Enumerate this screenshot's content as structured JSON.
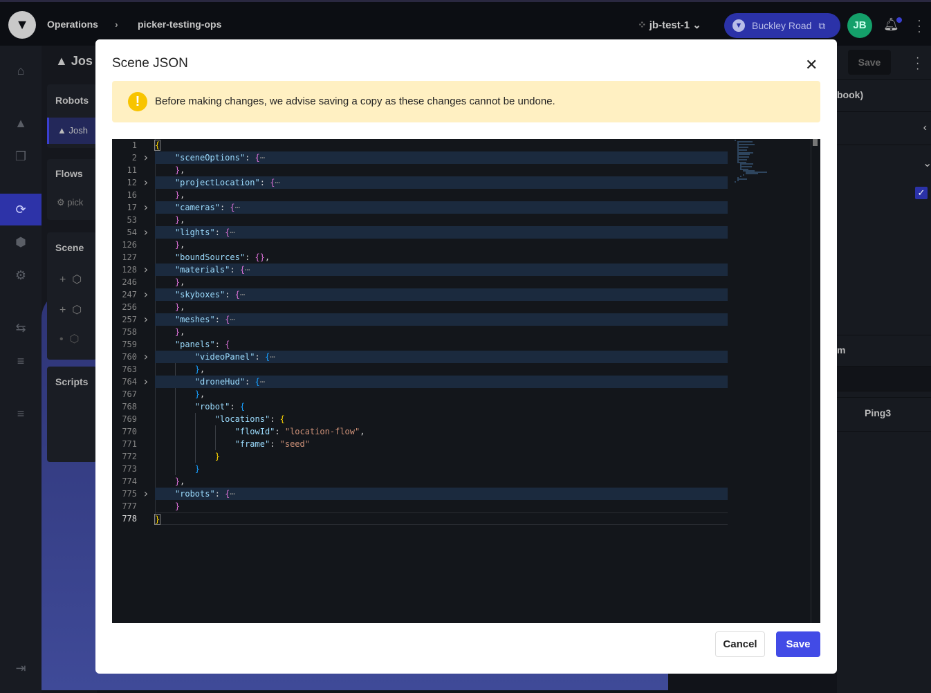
{
  "topbar": {
    "breadcrumb": [
      "Operations",
      "picker-testing-ops"
    ],
    "project": "jb-test-1",
    "site": "Buckley Road",
    "avatar_initials": "JB"
  },
  "background": {
    "robot_header": "Jos",
    "cards": {
      "robots": "Robots",
      "robot_item": "Josh",
      "flows": "Flows",
      "flow_item": "pick",
      "scene": "Scene",
      "scripts": "Scripts"
    },
    "right": {
      "save": "Save",
      "row1": "book)",
      "row2": "m",
      "row3": "Ping3"
    }
  },
  "modal": {
    "title": "Scene JSON",
    "warning": "Before making changes, we advise saving a copy as these changes cannot be undone.",
    "cancel": "Cancel",
    "save": "Save",
    "editor": {
      "lines": [
        {
          "n": "1",
          "fold": false,
          "tokens": [
            [
              "{",
              "b1 cursor"
            ]
          ]
        },
        {
          "n": "2",
          "fold": true,
          "tokens": [
            [
              "    ",
              ""
            ],
            [
              "\"sceneOptions\"",
              "k"
            ],
            [
              ": ",
              ""
            ],
            [
              "{",
              "b2"
            ],
            [
              "⋯",
              "e"
            ]
          ]
        },
        {
          "n": "11",
          "fold": false,
          "tokens": [
            [
              "    ",
              ""
            ],
            [
              "}",
              "b2"
            ],
            [
              ",",
              ""
            ]
          ]
        },
        {
          "n": "12",
          "fold": true,
          "tokens": [
            [
              "    ",
              ""
            ],
            [
              "\"projectLocation\"",
              "k"
            ],
            [
              ": ",
              ""
            ],
            [
              "{",
              "b2"
            ],
            [
              "⋯",
              "e"
            ]
          ]
        },
        {
          "n": "16",
          "fold": false,
          "tokens": [
            [
              "    ",
              ""
            ],
            [
              "}",
              "b2"
            ],
            [
              ",",
              ""
            ]
          ]
        },
        {
          "n": "17",
          "fold": true,
          "tokens": [
            [
              "    ",
              ""
            ],
            [
              "\"cameras\"",
              "k"
            ],
            [
              ": ",
              ""
            ],
            [
              "{",
              "b2"
            ],
            [
              "⋯",
              "e"
            ]
          ]
        },
        {
          "n": "53",
          "fold": false,
          "tokens": [
            [
              "    ",
              ""
            ],
            [
              "}",
              "b2"
            ],
            [
              ",",
              ""
            ]
          ]
        },
        {
          "n": "54",
          "fold": true,
          "tokens": [
            [
              "    ",
              ""
            ],
            [
              "\"lights\"",
              "k"
            ],
            [
              ": ",
              ""
            ],
            [
              "{",
              "b2"
            ],
            [
              "⋯",
              "e"
            ]
          ]
        },
        {
          "n": "126",
          "fold": false,
          "tokens": [
            [
              "    ",
              ""
            ],
            [
              "}",
              "b2"
            ],
            [
              ",",
              ""
            ]
          ]
        },
        {
          "n": "127",
          "fold": false,
          "tokens": [
            [
              "    ",
              ""
            ],
            [
              "\"boundSources\"",
              "k"
            ],
            [
              ": ",
              ""
            ],
            [
              "{}",
              "b2"
            ],
            [
              ",",
              ""
            ]
          ]
        },
        {
          "n": "128",
          "fold": true,
          "tokens": [
            [
              "    ",
              ""
            ],
            [
              "\"materials\"",
              "k"
            ],
            [
              ": ",
              ""
            ],
            [
              "{",
              "b2"
            ],
            [
              "⋯",
              "e"
            ]
          ]
        },
        {
          "n": "246",
          "fold": false,
          "tokens": [
            [
              "    ",
              ""
            ],
            [
              "}",
              "b2"
            ],
            [
              ",",
              ""
            ]
          ]
        },
        {
          "n": "247",
          "fold": true,
          "tokens": [
            [
              "    ",
              ""
            ],
            [
              "\"skyboxes\"",
              "k"
            ],
            [
              ": ",
              ""
            ],
            [
              "{",
              "b2"
            ],
            [
              "⋯",
              "e"
            ]
          ]
        },
        {
          "n": "256",
          "fold": false,
          "tokens": [
            [
              "    ",
              ""
            ],
            [
              "}",
              "b2"
            ],
            [
              ",",
              ""
            ]
          ]
        },
        {
          "n": "257",
          "fold": true,
          "tokens": [
            [
              "    ",
              ""
            ],
            [
              "\"meshes\"",
              "k"
            ],
            [
              ": ",
              ""
            ],
            [
              "{",
              "b2"
            ],
            [
              "⋯",
              "e"
            ]
          ]
        },
        {
          "n": "758",
          "fold": false,
          "tokens": [
            [
              "    ",
              ""
            ],
            [
              "}",
              "b2"
            ],
            [
              ",",
              ""
            ]
          ]
        },
        {
          "n": "759",
          "fold": false,
          "tokens": [
            [
              "    ",
              ""
            ],
            [
              "\"panels\"",
              "k"
            ],
            [
              ": ",
              ""
            ],
            [
              "{",
              "b2"
            ]
          ]
        },
        {
          "n": "760",
          "fold": true,
          "tokens": [
            [
              "        ",
              ""
            ],
            [
              "\"videoPanel\"",
              "k"
            ],
            [
              ": ",
              ""
            ],
            [
              "{",
              "b3"
            ],
            [
              "⋯",
              "e"
            ]
          ]
        },
        {
          "n": "763",
          "fold": false,
          "tokens": [
            [
              "        ",
              ""
            ],
            [
              "}",
              "b3"
            ],
            [
              ",",
              ""
            ]
          ]
        },
        {
          "n": "764",
          "fold": true,
          "tokens": [
            [
              "        ",
              ""
            ],
            [
              "\"droneHud\"",
              "k"
            ],
            [
              ": ",
              ""
            ],
            [
              "{",
              "b3"
            ],
            [
              "⋯",
              "e"
            ]
          ]
        },
        {
          "n": "767",
          "fold": false,
          "tokens": [
            [
              "        ",
              ""
            ],
            [
              "}",
              "b3"
            ],
            [
              ",",
              ""
            ]
          ]
        },
        {
          "n": "768",
          "fold": false,
          "tokens": [
            [
              "        ",
              ""
            ],
            [
              "\"robot\"",
              "k"
            ],
            [
              ": ",
              ""
            ],
            [
              "{",
              "b3"
            ]
          ]
        },
        {
          "n": "769",
          "fold": false,
          "tokens": [
            [
              "            ",
              ""
            ],
            [
              "\"locations\"",
              "k"
            ],
            [
              ": ",
              ""
            ],
            [
              "{",
              "b1"
            ]
          ]
        },
        {
          "n": "770",
          "fold": false,
          "tokens": [
            [
              "                ",
              ""
            ],
            [
              "\"flowId\"",
              "k"
            ],
            [
              ": ",
              ""
            ],
            [
              "\"location-flow\"",
              "s"
            ],
            [
              ",",
              ""
            ]
          ]
        },
        {
          "n": "771",
          "fold": false,
          "tokens": [
            [
              "                ",
              ""
            ],
            [
              "\"frame\"",
              "k"
            ],
            [
              ": ",
              ""
            ],
            [
              "\"seed\"",
              "s"
            ]
          ]
        },
        {
          "n": "772",
          "fold": false,
          "tokens": [
            [
              "            ",
              ""
            ],
            [
              "}",
              "b1"
            ]
          ]
        },
        {
          "n": "773",
          "fold": false,
          "tokens": [
            [
              "        ",
              ""
            ],
            [
              "}",
              "b3"
            ]
          ]
        },
        {
          "n": "774",
          "fold": false,
          "tokens": [
            [
              "    ",
              ""
            ],
            [
              "}",
              "b2"
            ],
            [
              ",",
              ""
            ]
          ]
        },
        {
          "n": "775",
          "fold": true,
          "tokens": [
            [
              "    ",
              ""
            ],
            [
              "\"robots\"",
              "k"
            ],
            [
              ": ",
              ""
            ],
            [
              "{",
              "b2"
            ],
            [
              "⋯",
              "e"
            ]
          ]
        },
        {
          "n": "777",
          "fold": false,
          "tokens": [
            [
              "    ",
              ""
            ],
            [
              "}",
              "b2"
            ]
          ]
        },
        {
          "n": "778",
          "fold": false,
          "current": true,
          "tokens": [
            [
              "}",
              "b1 cursor"
            ]
          ]
        }
      ]
    }
  },
  "colors": {
    "accent": "#424be6",
    "warning_bg": "#fff0c2",
    "warning_icon": "#f8c400",
    "avatar": "#14a06a"
  }
}
